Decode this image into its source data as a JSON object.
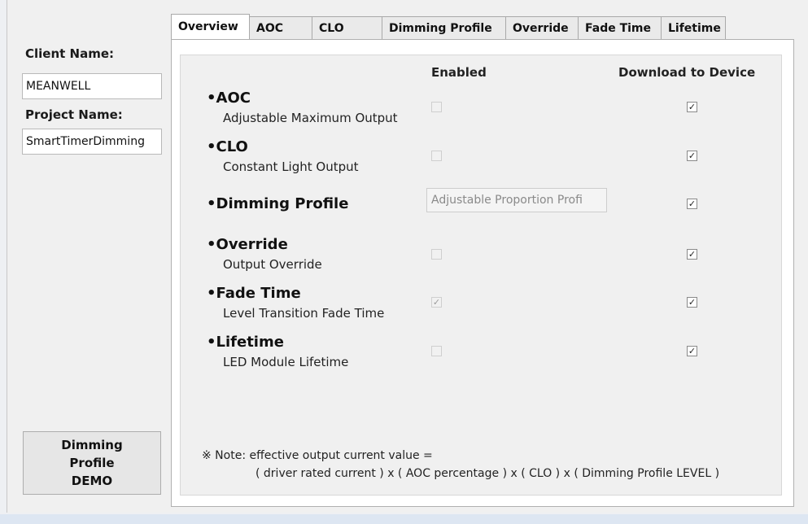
{
  "left_panel": {
    "client_name_label": "Client Name:",
    "client_name_value": "MEANWELL",
    "project_name_label": "Project Name:",
    "project_name_value": "SmartTimerDimming",
    "demo_button_lines": [
      "Dimming",
      "Profile",
      "DEMO"
    ]
  },
  "tabs": [
    {
      "label": "Overview",
      "active": true
    },
    {
      "label": "AOC",
      "active": false
    },
    {
      "label": "CLO",
      "active": false
    },
    {
      "label": "Dimming Profile",
      "active": false
    },
    {
      "label": "Override",
      "active": false
    },
    {
      "label": "Fade Time",
      "active": false
    },
    {
      "label": "Lifetime",
      "active": false
    }
  ],
  "overview": {
    "col_enabled": "Enabled",
    "col_download": "Download to Device",
    "features": [
      {
        "title": "AOC",
        "subtitle": "Adjustable Maximum Output",
        "enabled": false,
        "download": true
      },
      {
        "title": "CLO",
        "subtitle": "Constant Light Output",
        "enabled": false,
        "download": true
      },
      {
        "title": "Dimming Profile",
        "subtitle": "",
        "enabled_value": "Adjustable Proportion Profi",
        "download": true
      },
      {
        "title": "Override",
        "subtitle": "Output Override",
        "enabled": false,
        "download": true
      },
      {
        "title": "Fade Time",
        "subtitle": "Level Transition Fade Time",
        "enabled": true,
        "download": true
      },
      {
        "title": "Lifetime",
        "subtitle": "LED Module Lifetime",
        "enabled": false,
        "download": true
      }
    ],
    "note_line1": "※ Note: effective output current value =",
    "note_line2": "( driver rated current ) x ( AOC percentage ) x ( CLO ) x ( Dimming Profile LEVEL )"
  },
  "icons": {
    "check": "✓",
    "bullet": "•"
  }
}
